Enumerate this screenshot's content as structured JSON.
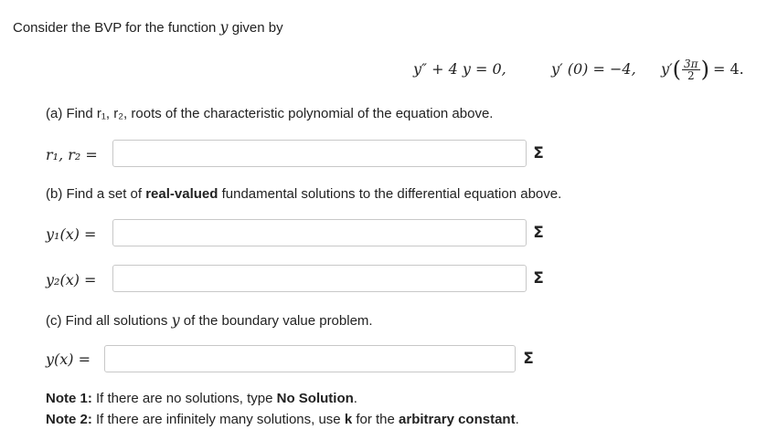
{
  "intro": {
    "prefix": "Consider the BVP for the function",
    "var": "y",
    "suffix": "given by"
  },
  "equation": {
    "ode": "y″ + 4 y = 0,",
    "bc1": "y′ (0) = −4,",
    "bc2_lhs": "y′",
    "bc2_num": "3π",
    "bc2_den": "2",
    "bc2_rhs": "= 4."
  },
  "part_a": {
    "text": "(a) Find r₁, r₂, roots of the characteristic polynomial of the equation above.",
    "label": "r₁, r₂ ="
  },
  "part_b": {
    "prefix": "(b) Find a set of",
    "bold": "real-valued",
    "suffix": "fundamental solutions to the differential equation above.",
    "label1": "y₁(x) =",
    "label2": "y₂(x) ="
  },
  "part_c": {
    "prefix": "(c) Find all solutions",
    "var": "y",
    "suffix": "of the boundary value problem.",
    "label": "y(x) ="
  },
  "notes": {
    "n1_label": "Note 1:",
    "n1_text": "If there are no solutions, type",
    "n1_bold": "No Solution",
    "n1_end": ".",
    "n2_label": "Note 2:",
    "n2_text": "If there are infinitely many solutions, use",
    "n2_k": "k",
    "n2_mid": "for the",
    "n2_bold": "arbitrary constant",
    "n2_end": "."
  },
  "inputs": {
    "r_value": "",
    "y1_value": "",
    "y2_value": "",
    "y_value": ""
  },
  "sigma_symbol": "Σ",
  "icons": {
    "equation_editor": "sigma-icon"
  }
}
